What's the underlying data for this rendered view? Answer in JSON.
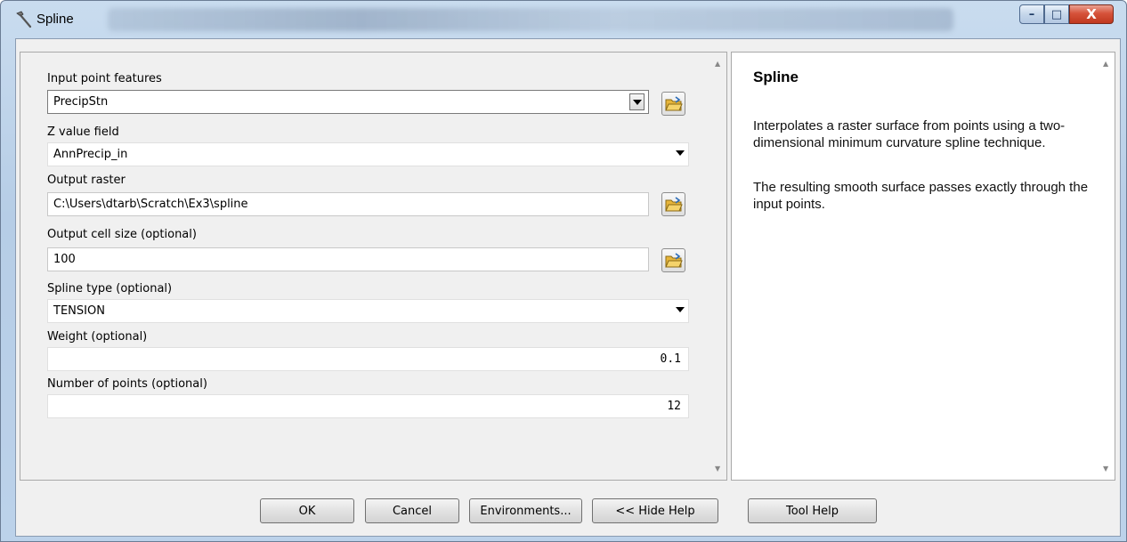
{
  "window": {
    "title": "Spline",
    "controls": {
      "minimize": "–",
      "maximize": "□",
      "close": "X"
    }
  },
  "params": [
    {
      "label": "Input point features",
      "value": "PrecipStn",
      "kind": "combo-with-button"
    },
    {
      "label": "Z value field",
      "value": "AnnPrecip_in",
      "kind": "dropdown"
    },
    {
      "label": "Output raster",
      "value": "C:\\Users\\dtarb\\Scratch\\Ex3\\spline",
      "kind": "text-with-folder"
    },
    {
      "label": "Output cell size (optional)",
      "value": "100",
      "kind": "text-with-folder"
    },
    {
      "label": "Spline type (optional)",
      "value": "TENSION",
      "kind": "dropdown"
    },
    {
      "label": "Weight (optional)",
      "value": "0.1",
      "kind": "number"
    },
    {
      "label": "Number of points (optional)",
      "value": "12",
      "kind": "number"
    }
  ],
  "help": {
    "title": "Spline",
    "paragraph1": "Interpolates a raster surface from points using a two-dimensional minimum curvature spline technique.",
    "paragraph2": "The resulting smooth surface passes exactly through the input points."
  },
  "buttons": {
    "ok": "OK",
    "cancel": "Cancel",
    "environments": "Environments...",
    "hide_help": "<< Hide Help",
    "tool_help": "Tool Help"
  },
  "colors": {
    "folder_icon": "#e7b53a",
    "close_button": "#d6533b"
  }
}
